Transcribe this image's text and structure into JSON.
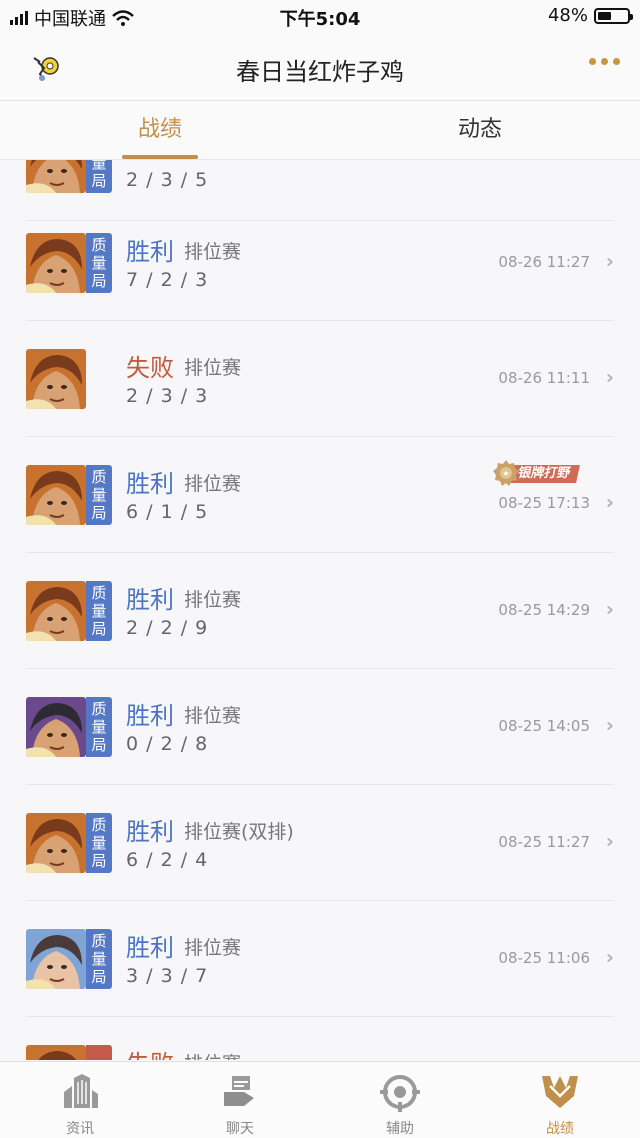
{
  "status_bar": {
    "carrier": "中国联通",
    "time": "下午5:04",
    "battery": "48%",
    "battery_level": 0.48
  },
  "header": {
    "title": "春日当红炸子鸡"
  },
  "tabs": [
    {
      "label": "战绩",
      "active": true
    },
    {
      "label": "动态",
      "active": false
    }
  ],
  "matches": [
    {
      "result": "",
      "mode": "",
      "kda": "2 / 3 / 5",
      "time": "",
      "badge": "质量局",
      "hero": "hero-brown",
      "outcome": "win",
      "medal": ""
    },
    {
      "result": "胜利",
      "mode": "排位赛",
      "kda": "7 / 2 / 3",
      "time": "08-26 11:27",
      "badge": "质量局",
      "hero": "hero-brown",
      "outcome": "win",
      "medal": ""
    },
    {
      "result": "失败",
      "mode": "排位赛",
      "kda": "2 / 3 / 3",
      "time": "08-26 11:11",
      "badge": "",
      "hero": "hero-brown",
      "outcome": "loss",
      "medal": ""
    },
    {
      "result": "胜利",
      "mode": "排位赛",
      "kda": "6 / 1 / 5",
      "time": "08-25 17:13",
      "badge": "质量局",
      "hero": "hero-brown",
      "outcome": "win",
      "medal": "银牌打野"
    },
    {
      "result": "胜利",
      "mode": "排位赛",
      "kda": "2 / 2 / 9",
      "time": "08-25 14:29",
      "badge": "质量局",
      "hero": "hero-brown",
      "outcome": "win",
      "medal": ""
    },
    {
      "result": "胜利",
      "mode": "排位赛",
      "kda": "0 / 2 / 8",
      "time": "08-25 14:05",
      "badge": "质量局",
      "hero": "hero-dark",
      "outcome": "win",
      "medal": ""
    },
    {
      "result": "胜利",
      "mode": "排位赛(双排)",
      "kda": "6 / 2 / 4",
      "time": "08-25 11:27",
      "badge": "质量局",
      "hero": "hero-brown",
      "outcome": "win",
      "medal": ""
    },
    {
      "result": "胜利",
      "mode": "排位赛",
      "kda": "3 / 3 / 7",
      "time": "08-25 11:06",
      "badge": "质量局",
      "hero": "hero-blue",
      "outcome": "win",
      "medal": ""
    },
    {
      "result": "失败",
      "mode": "排位赛",
      "kda": "",
      "time": "",
      "badge": "尽",
      "hero": "hero-brown",
      "outcome": "loss",
      "medal": ""
    }
  ],
  "bottom_nav": [
    {
      "label": "资讯",
      "icon": "buildings-icon",
      "active": false
    },
    {
      "label": "聊天",
      "icon": "chat-icon",
      "active": false
    },
    {
      "label": "辅助",
      "icon": "target-icon",
      "active": false
    },
    {
      "label": "战绩",
      "icon": "trophy-icon",
      "active": true
    }
  ],
  "colors": {
    "accent": "#c0904a",
    "win": "#4e74c4",
    "loss": "#c25b3b",
    "badge": "#5578c6"
  }
}
